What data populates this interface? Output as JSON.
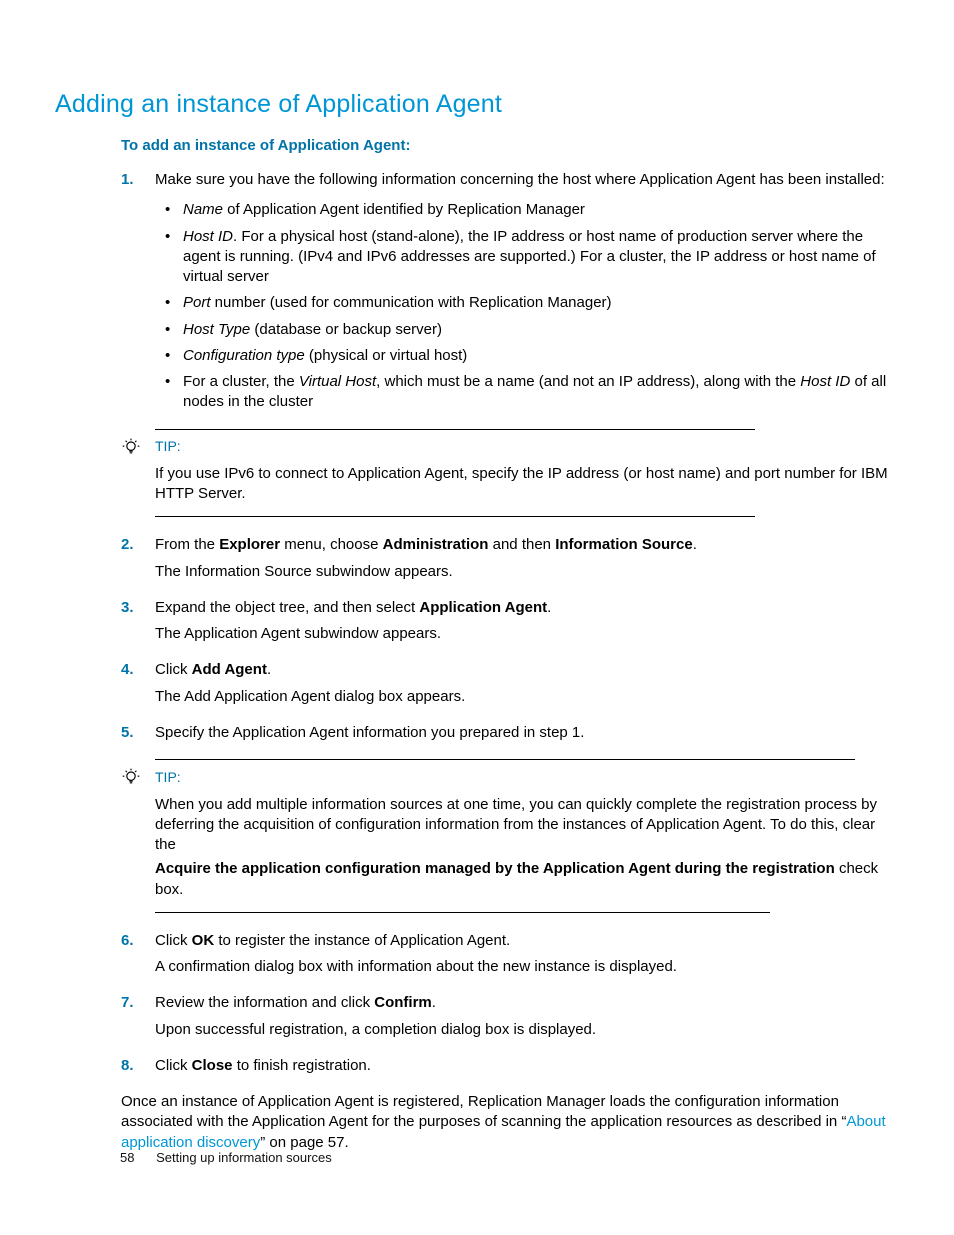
{
  "heading": "Adding an instance of Application Agent",
  "intro": "To add an instance of Application Agent:",
  "steps": {
    "s1": {
      "num": "1.",
      "text": "Make sure you have the following information concerning the host where Application Agent has been installed:",
      "bullets": {
        "b1a": "Name",
        "b1b": " of Application Agent identified by Replication Manager",
        "b2a": "Host ID",
        "b2b": ". For a physical host (stand-alone), the IP address or host name of production server where the agent is running. (IPv4 and IPv6 addresses are supported.) For a cluster, the IP address or host name of virtual server",
        "b3a": "Port",
        "b3b": " number (used for communication with Replication Manager)",
        "b4a": "Host Type",
        "b4b": " (database or backup server)",
        "b5a": "Configuration type",
        "b5b": " (physical or virtual host)",
        "b6a": "For a cluster, the ",
        "b6b": "Virtual Host",
        "b6c": ", which must be a name (and not an IP address), along with the ",
        "b6d": "Host ID",
        "b6e": " of all nodes in the cluster"
      }
    },
    "s2": {
      "num": "2.",
      "t1": "From the ",
      "t2": "Explorer",
      "t3": " menu, choose ",
      "t4": "Administration",
      "t5": " and then ",
      "t6": "Information Source",
      "t7": ".",
      "sub": "The Information Source subwindow appears."
    },
    "s3": {
      "num": "3.",
      "t1": "Expand the object tree, and then select ",
      "t2": "Application Agent",
      "t3": ".",
      "sub": "The Application Agent subwindow appears."
    },
    "s4": {
      "num": "4.",
      "t1": "Click ",
      "t2": "Add Agent",
      "t3": ".",
      "sub": "The Add Application Agent dialog box appears."
    },
    "s5": {
      "num": "5.",
      "text": "Specify the Application Agent information you prepared in step 1."
    },
    "s6": {
      "num": "6.",
      "t1": "Click ",
      "t2": "OK",
      "t3": " to register the instance of Application Agent.",
      "sub": "A confirmation dialog box with information about the new instance is displayed."
    },
    "s7": {
      "num": "7.",
      "t1": "Review the information and click ",
      "t2": "Confirm",
      "t3": ".",
      "sub": "Upon successful registration, a completion dialog box is displayed."
    },
    "s8": {
      "num": "8.",
      "t1": "Click ",
      "t2": "Close",
      "t3": " to finish registration."
    }
  },
  "tip1": {
    "label": "TIP:",
    "body": "If you use IPv6 to connect to Application Agent, specify the IP address (or host name) and port number for IBM HTTP Server."
  },
  "tip2": {
    "label": "TIP:",
    "p1": "When you add multiple information sources at one time, you can quickly complete the registration process by deferring the acquisition of configuration information from the instances of Application Agent. To do this, clear the",
    "p2": "Acquire the application configuration managed by the Application Agent during the registration",
    "p3": "check box."
  },
  "closing": {
    "t1": "Once an instance of Application Agent is registered, Replication Manager loads the configuration information associated with the Application Agent for the purposes of scanning the application resources as described in “",
    "link": "About application discovery",
    "t2": "” on page 57."
  },
  "footer": {
    "page": "58",
    "section": "Setting up information sources"
  }
}
